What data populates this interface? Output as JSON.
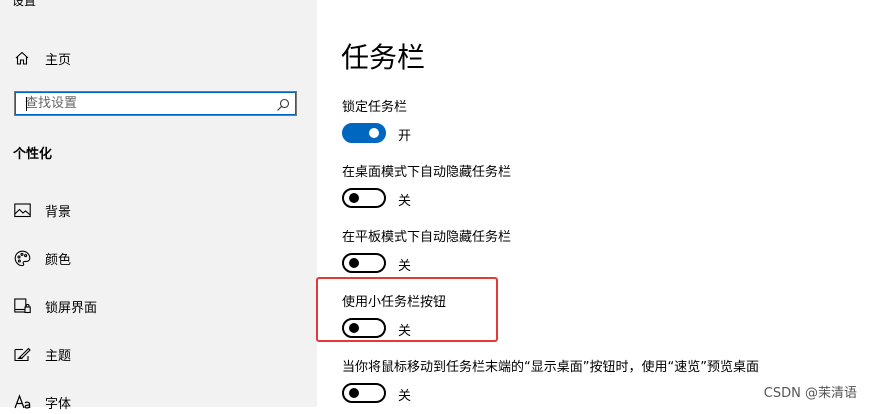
{
  "app": {
    "title": "设置"
  },
  "sidebar": {
    "home_label": "主页",
    "search_placeholder": "查找设置",
    "section_title": "个性化",
    "items": [
      {
        "label": "背景",
        "icon": "image-icon"
      },
      {
        "label": "颜色",
        "icon": "palette-icon"
      },
      {
        "label": "锁屏界面",
        "icon": "lock-screen-icon"
      },
      {
        "label": "主题",
        "icon": "theme-icon"
      },
      {
        "label": "字体",
        "icon": "font-icon"
      }
    ]
  },
  "main": {
    "title": "任务栏",
    "settings": [
      {
        "label": "锁定任务栏",
        "on": true,
        "state_text": "开"
      },
      {
        "label": "在桌面模式下自动隐藏任务栏",
        "on": false,
        "state_text": "关"
      },
      {
        "label": "在平板模式下自动隐藏任务栏",
        "on": false,
        "state_text": "关"
      },
      {
        "label": "使用小任务栏按钮",
        "on": false,
        "state_text": "关"
      },
      {
        "label": "当你将鼠标移动到任务栏末端的“显示桌面”按钮时，使用“速览”预览桌面",
        "on": false,
        "state_text": "关"
      }
    ]
  },
  "colors": {
    "sidebar_bg": "#f2f2f2",
    "accent": "#0067c0",
    "highlight": "#e53935"
  },
  "watermark": "CSDN @茉清语"
}
